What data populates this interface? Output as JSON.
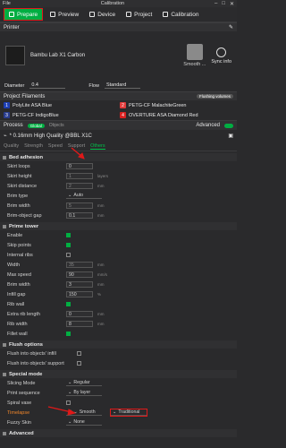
{
  "menu": {
    "file": "File",
    "title": "Calibration"
  },
  "tabs": [
    {
      "label": "Prepare"
    },
    {
      "label": "Preview"
    },
    {
      "label": "Device"
    },
    {
      "label": "Project"
    },
    {
      "label": "Calibration"
    }
  ],
  "printer": {
    "section": "Printer",
    "name": "Bambu Lab X1 Carbon",
    "plate": "Smooth ...",
    "sync": "Sync info"
  },
  "diameter": {
    "label": "Diameter",
    "value": "0.4",
    "flow_label": "Flow",
    "flow_value": "Standard"
  },
  "filaments": {
    "section": "Project Filaments",
    "badge": "Flushing volumes",
    "items": [
      {
        "n": "1",
        "name": "PolyLite ASA Blue",
        "color": "#1e3fb3"
      },
      {
        "n": "2",
        "name": "PETG-CF MalachiteGreen",
        "color": "#e23b3b"
      },
      {
        "n": "3",
        "name": "PETG-CF IndigoBlue",
        "color": "#2a3d8f"
      },
      {
        "n": "4",
        "name": "OVERTURE ASA Diamond Red",
        "color": "#d92020"
      }
    ]
  },
  "process": {
    "section": "Process",
    "global": "Global",
    "objects": "Objects",
    "advanced": "Advanced",
    "preset": "* 0.16mm High Quality @BBL X1C"
  },
  "subtabs": [
    "Quality",
    "Strength",
    "Speed",
    "Support",
    "Others"
  ],
  "bed": {
    "title": "Bed adhesion",
    "rows": [
      {
        "label": "Skirt loops",
        "value": "0",
        "unit": ""
      },
      {
        "label": "Skirt height",
        "value": "1",
        "unit": "layers"
      },
      {
        "label": "Skirt distance",
        "value": "2",
        "unit": "mm"
      },
      {
        "label": "Brim type",
        "value": "Auto",
        "unit": ""
      },
      {
        "label": "Brim width",
        "value": "5",
        "unit": "mm"
      },
      {
        "label": "Brim-object gap",
        "value": "0.1",
        "unit": "mm"
      }
    ]
  },
  "prime": {
    "title": "Prime tower",
    "rows": [
      {
        "label": "Enable",
        "value": "",
        "unit": ""
      },
      {
        "label": "Skip points",
        "value": "",
        "unit": ""
      },
      {
        "label": "Internal ribs",
        "value": "",
        "unit": ""
      },
      {
        "label": "Width",
        "value": "35",
        "unit": "mm"
      },
      {
        "label": "Max speed",
        "value": "90",
        "unit": "mm/s"
      },
      {
        "label": "Brim width",
        "value": "3",
        "unit": "mm"
      },
      {
        "label": "Infill gap",
        "value": "150",
        "unit": "%"
      },
      {
        "label": "Rib wall",
        "value": "",
        "unit": ""
      },
      {
        "label": "Extra rib length",
        "value": "0",
        "unit": "mm"
      },
      {
        "label": "Rib width",
        "value": "8",
        "unit": "mm"
      },
      {
        "label": "Fillet wall",
        "value": "",
        "unit": ""
      }
    ]
  },
  "flush": {
    "title": "Flush options",
    "rows": [
      {
        "label": "Flush into objects' infill"
      },
      {
        "label": "Flush into objects' support"
      }
    ]
  },
  "special": {
    "title": "Special mode",
    "rows": [
      {
        "label": "Slicing Mode",
        "value": "Regular"
      },
      {
        "label": "Print sequence",
        "value": "By layer"
      },
      {
        "label": "Spiral vase",
        "value": ""
      },
      {
        "label": "Timelapse",
        "value": "Smooth",
        "option": "Traditional"
      },
      {
        "label": "Fuzzy Skin",
        "value": "None"
      }
    ]
  },
  "advanced_section": "Advanced"
}
